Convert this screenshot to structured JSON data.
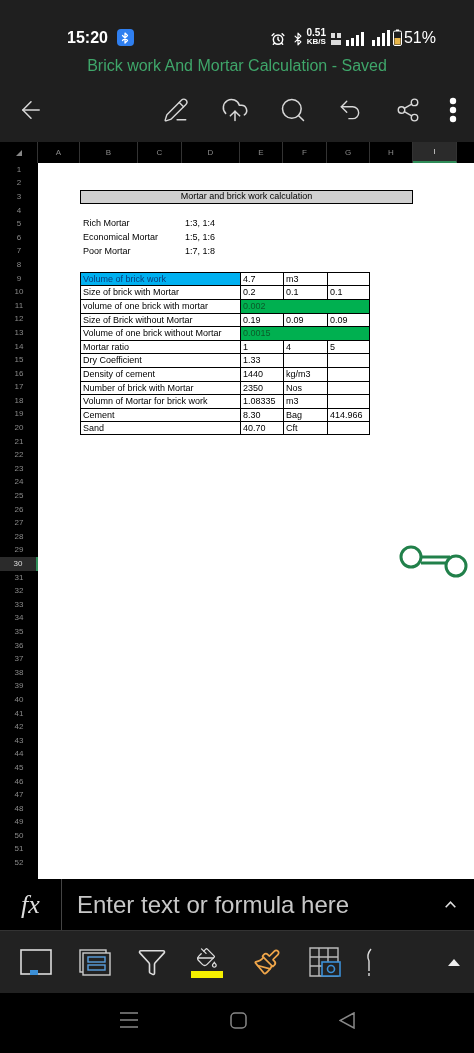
{
  "status_bar": {
    "time": "15:20",
    "speed": "0.51",
    "speed_unit": "KB/S",
    "battery": "51%"
  },
  "document_title": "Brick work And Mortar Calculation - Saved",
  "sheet": {
    "columns": [
      {
        "label": "A",
        "selected": false
      },
      {
        "label": "B",
        "selected": false
      },
      {
        "label": "C",
        "selected": false
      },
      {
        "label": "D",
        "selected": false
      },
      {
        "label": "E",
        "selected": false
      },
      {
        "label": "F",
        "selected": false
      },
      {
        "label": "G",
        "selected": false
      },
      {
        "label": "H",
        "selected": false
      },
      {
        "label": "I",
        "selected": true
      }
    ],
    "rows": [
      {
        "label": "1",
        "selected": false
      },
      {
        "label": "2",
        "selected": false
      },
      {
        "label": "3",
        "selected": false
      },
      {
        "label": "4",
        "selected": false
      },
      {
        "label": "5",
        "selected": false
      },
      {
        "label": "6",
        "selected": false
      },
      {
        "label": "7",
        "selected": false
      },
      {
        "label": "8",
        "selected": false
      },
      {
        "label": "9",
        "selected": false
      },
      {
        "label": "10",
        "selected": false
      },
      {
        "label": "11",
        "selected": false
      },
      {
        "label": "12",
        "selected": false
      },
      {
        "label": "13",
        "selected": false
      },
      {
        "label": "14",
        "selected": false
      },
      {
        "label": "15",
        "selected": false
      },
      {
        "label": "16",
        "selected": false
      },
      {
        "label": "17",
        "selected": false
      },
      {
        "label": "18",
        "selected": false
      },
      {
        "label": "19",
        "selected": false
      },
      {
        "label": "20",
        "selected": false
      },
      {
        "label": "21",
        "selected": false
      },
      {
        "label": "22",
        "selected": false
      },
      {
        "label": "23",
        "selected": false
      },
      {
        "label": "24",
        "selected": false
      },
      {
        "label": "25",
        "selected": false
      },
      {
        "label": "26",
        "selected": false
      },
      {
        "label": "27",
        "selected": false
      },
      {
        "label": "28",
        "selected": false
      },
      {
        "label": "29",
        "selected": false
      },
      {
        "label": "30",
        "selected": true
      },
      {
        "label": "31",
        "selected": false
      },
      {
        "label": "32",
        "selected": false
      },
      {
        "label": "33",
        "selected": false
      },
      {
        "label": "34",
        "selected": false
      },
      {
        "label": "35",
        "selected": false
      },
      {
        "label": "36",
        "selected": false
      },
      {
        "label": "37",
        "selected": false
      },
      {
        "label": "38",
        "selected": false
      },
      {
        "label": "39",
        "selected": false
      },
      {
        "label": "40",
        "selected": false
      },
      {
        "label": "41",
        "selected": false
      },
      {
        "label": "42",
        "selected": false
      },
      {
        "label": "43",
        "selected": false
      },
      {
        "label": "44",
        "selected": false
      },
      {
        "label": "45",
        "selected": false
      },
      {
        "label": "46",
        "selected": false
      },
      {
        "label": "47",
        "selected": false
      },
      {
        "label": "48",
        "selected": false
      },
      {
        "label": "49",
        "selected": false
      },
      {
        "label": "50",
        "selected": false
      },
      {
        "label": "51",
        "selected": false
      },
      {
        "label": "52",
        "selected": false
      }
    ],
    "title": "Mortar and brick work calculation",
    "mortar_types": [
      {
        "name": "Rich Mortar",
        "ratio": "1:3, 1:4"
      },
      {
        "name": "Economical Mortar",
        "ratio": "1:5, 1:6"
      },
      {
        "name": "Poor Mortar",
        "ratio": "1:7, 1:8"
      }
    ],
    "table": [
      {
        "kind": "split",
        "label": "Volume of brick work",
        "color": "#00b0f0",
        "values": [
          "4.7",
          "m3"
        ]
      },
      {
        "kind": "split",
        "label": "Size of brick with Mortar",
        "values": [
          "0.2",
          "0.1",
          "0.1"
        ]
      },
      {
        "kind": "merged",
        "label": "volume of one brick with mortar",
        "value": "0.002",
        "color": "#00b050"
      },
      {
        "kind": "split",
        "label": "Size of Brick without Mortar",
        "values": [
          "0.19",
          "0.09",
          "0.09"
        ]
      },
      {
        "kind": "merged",
        "label": "Volume of one brick without Mortar",
        "value": "0.0015",
        "color": "#00b050"
      },
      {
        "kind": "split",
        "label": "Mortar ratio",
        "values": [
          "1",
          "4",
          "5"
        ]
      },
      {
        "kind": "split",
        "label": "Dry Coefficient",
        "values": [
          "1.33"
        ]
      },
      {
        "kind": "split",
        "label": "Density of cement",
        "values": [
          "1440",
          "kg/m3"
        ]
      },
      {
        "kind": "split",
        "label": "Number of brick with Mortar",
        "values": [
          "2350",
          "Nos"
        ]
      },
      {
        "kind": "split",
        "label": "Volumn of Mortar for brick work",
        "values": [
          "1.08335",
          "m3"
        ]
      },
      {
        "kind": "split",
        "label": "Cement",
        "values": [
          "8.30",
          "Bag",
          "414.966"
        ]
      },
      {
        "kind": "split",
        "label": "Sand",
        "values": [
          "40.70",
          "Cft"
        ]
      }
    ]
  },
  "formula_bar": {
    "label": "fx",
    "placeholder": "Enter text or formula here"
  }
}
